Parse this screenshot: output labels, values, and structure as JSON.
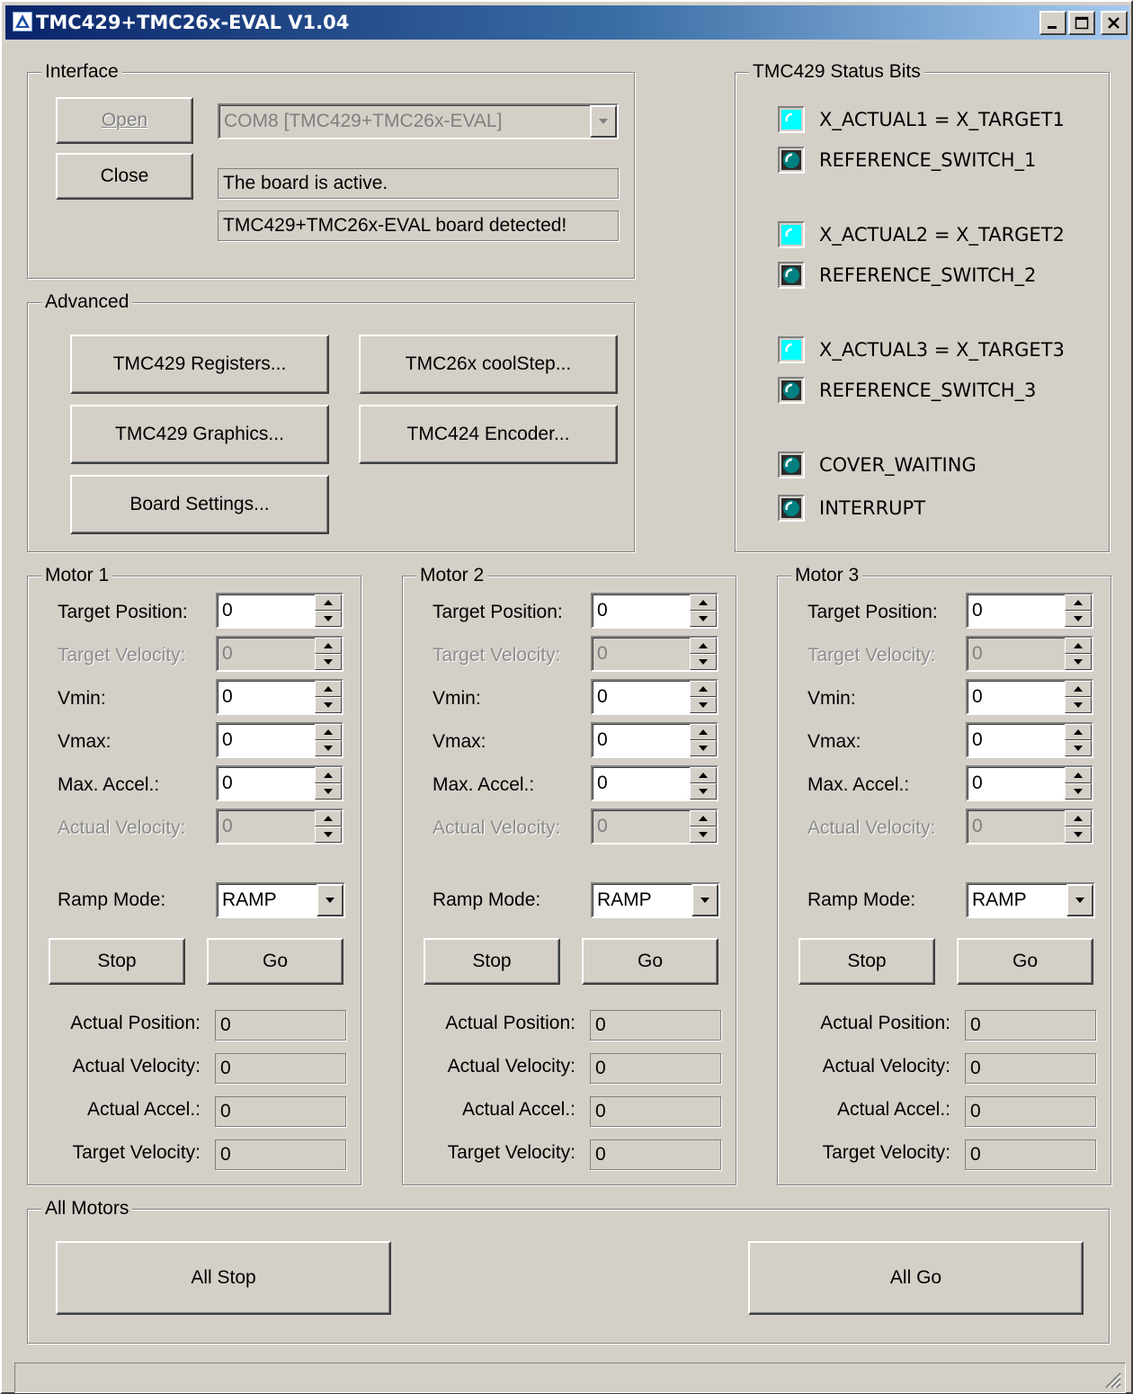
{
  "window": {
    "title": "TMC429+TMC26x-EVAL V1.04",
    "title_icon": "app-logo-icon",
    "controls": [
      "minimize-icon",
      "maximize-icon",
      "close-icon"
    ]
  },
  "interface": {
    "title": "Interface",
    "open_label": "Open",
    "close_label": "Close",
    "port_value": "COM8  [TMC429+TMC26x-EVAL]",
    "status_line_1": "The board is active.",
    "status_line_2": "TMC429+TMC26x-EVAL board detected!"
  },
  "advanced": {
    "title": "Advanced",
    "buttons": [
      "TMC429 Registers...",
      "TMC26x coolStep...",
      "TMC429 Graphics...",
      "TMC424 Encoder...",
      "Board Settings..."
    ]
  },
  "status_bits": {
    "title": "TMC429 Status Bits",
    "items": [
      {
        "label": "X_ACTUAL1 = X_TARGET1",
        "state": "on"
      },
      {
        "label": "REFERENCE_SWITCH_1",
        "state": "off"
      },
      {
        "label": "X_ACTUAL2 = X_TARGET2",
        "state": "on"
      },
      {
        "label": "REFERENCE_SWITCH_2",
        "state": "off"
      },
      {
        "label": "X_ACTUAL3 = X_TARGET3",
        "state": "on"
      },
      {
        "label": "REFERENCE_SWITCH_3",
        "state": "off"
      },
      {
        "label": "COVER_WAITING",
        "state": "off"
      },
      {
        "label": "INTERRUPT",
        "state": "off"
      }
    ],
    "colors": {
      "on": "#00ffff",
      "off": "#008080"
    }
  },
  "motor_labels": {
    "target_position": "Target Position:",
    "target_velocity": "Target Velocity:",
    "vmin": "Vmin:",
    "vmax": "Vmax:",
    "max_accel": "Max. Accel.:",
    "actual_velocity": "Actual Velocity:",
    "ramp_mode": "Ramp Mode:",
    "stop": "Stop",
    "go": "Go",
    "ro_actual_position": "Actual Position:",
    "ro_actual_velocity": "Actual Velocity:",
    "ro_actual_accel": "Actual Accel.:",
    "ro_target_velocity": "Target Velocity:"
  },
  "motors": [
    {
      "title": "Motor 1",
      "target_position": "0",
      "target_velocity": "0",
      "vmin": "0",
      "vmax": "0",
      "max_accel": "0",
      "actual_velocity": "0",
      "ramp_mode": "RAMP",
      "actual_position_ro": "0",
      "actual_velocity_ro": "0",
      "actual_accel_ro": "0",
      "target_velocity_ro": "0"
    },
    {
      "title": "Motor 2",
      "target_position": "0",
      "target_velocity": "0",
      "vmin": "0",
      "vmax": "0",
      "max_accel": "0",
      "actual_velocity": "0",
      "ramp_mode": "RAMP",
      "actual_position_ro": "0",
      "actual_velocity_ro": "0",
      "actual_accel_ro": "0",
      "target_velocity_ro": "0"
    },
    {
      "title": "Motor 3",
      "target_position": "0",
      "target_velocity": "0",
      "vmin": "0",
      "vmax": "0",
      "max_accel": "0",
      "actual_velocity": "0",
      "ramp_mode": "RAMP",
      "actual_position_ro": "0",
      "actual_velocity_ro": "0",
      "actual_accel_ro": "0",
      "target_velocity_ro": "0"
    }
  ],
  "all_motors": {
    "title": "All Motors",
    "all_stop_label": "All Stop",
    "all_go_label": "All Go"
  }
}
